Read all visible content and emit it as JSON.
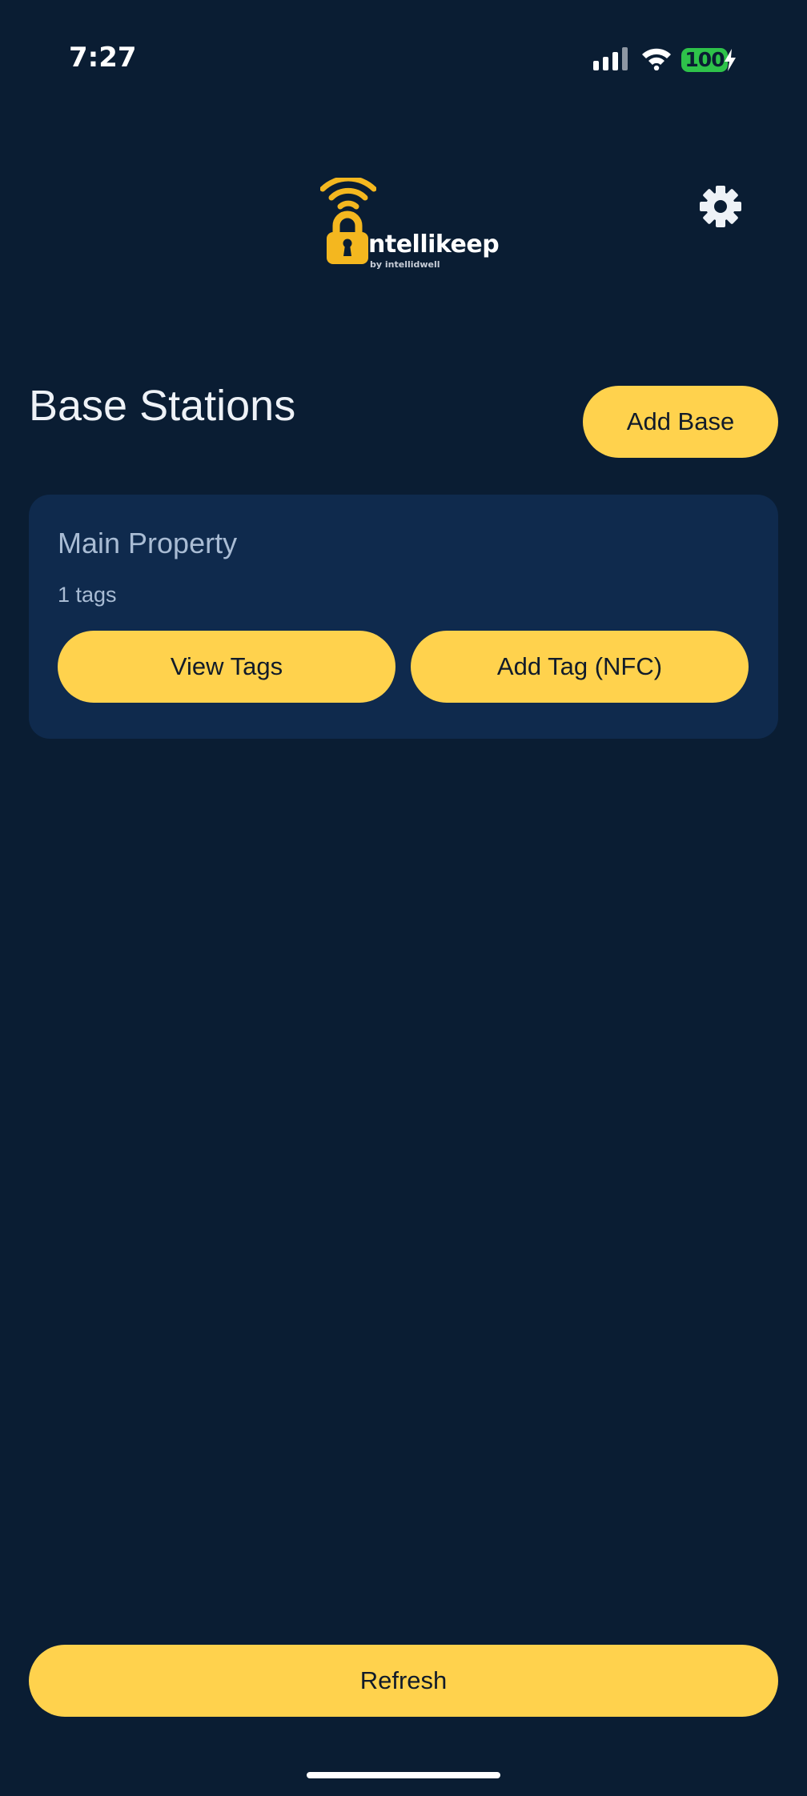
{
  "status_bar": {
    "time": "7:27",
    "battery_level": "100",
    "icons": [
      "signal-icon",
      "wifi-icon",
      "battery-icon",
      "charging-bolt-icon"
    ]
  },
  "header": {
    "logo_name": "ntellikeep",
    "logo_sub": "by intellidwell",
    "settings_icon": "gear-icon"
  },
  "main": {
    "title": "Base Stations",
    "add_base_label": "Add Base",
    "bases": [
      {
        "name": "Main Property",
        "tag_count": "1 tags",
        "view_tags_label": "View Tags",
        "add_tag_label": "Add Tag (NFC)"
      }
    ]
  },
  "footer": {
    "refresh_label": "Refresh"
  },
  "colors": {
    "background": "#0a1d33",
    "card": "#0f2a4d",
    "accent": "#ffd24d",
    "logo_gold": "#f4b71f",
    "battery_green": "#2ec24a"
  }
}
